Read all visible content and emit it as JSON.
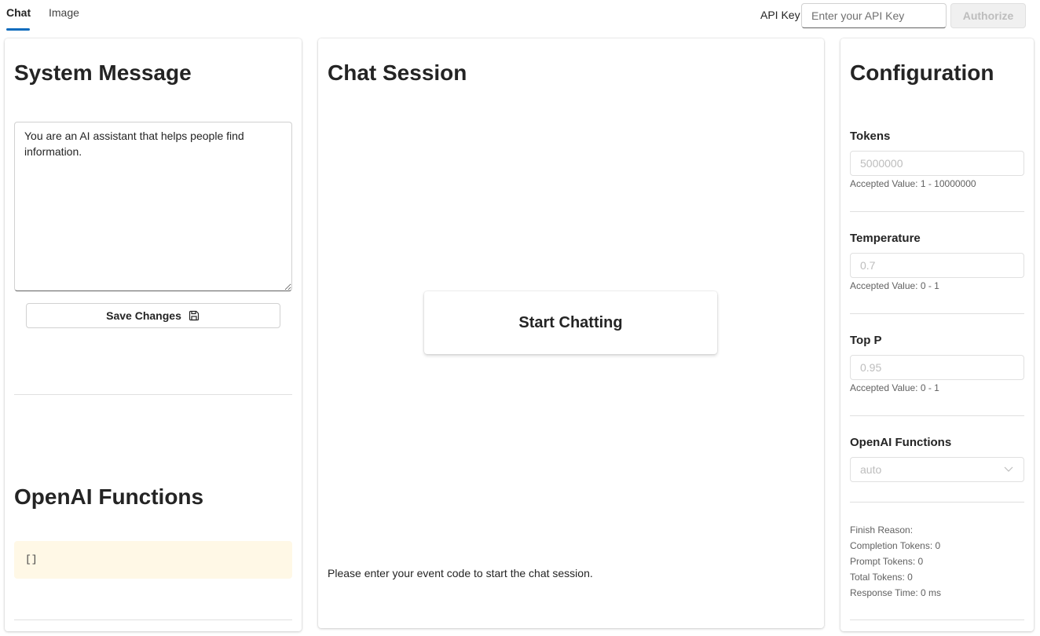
{
  "tabs": [
    {
      "label": "Chat",
      "active": true
    },
    {
      "label": "Image",
      "active": false
    }
  ],
  "auth": {
    "label": "API Key",
    "placeholder": "Enter your API Key",
    "value": "",
    "button_label": "Authorize"
  },
  "system_message": {
    "title": "System Message",
    "text": "You are an AI assistant that helps people find information.",
    "save_label": "Save Changes"
  },
  "functions_panel": {
    "title": "OpenAI Functions",
    "content": "[]"
  },
  "chat_session": {
    "title": "Chat Session",
    "start_label": "Start Chatting",
    "message": "Please enter your event code to start the chat session."
  },
  "configuration": {
    "title": "Configuration",
    "tokens": {
      "label": "Tokens",
      "placeholder": "5000000",
      "hint": "Accepted Value: 1 - 10000000"
    },
    "temperature": {
      "label": "Temperature",
      "placeholder": "0.7",
      "hint": "Accepted Value: 0 - 1"
    },
    "top_p": {
      "label": "Top P",
      "placeholder": "0.95",
      "hint": "Accepted Value: 0 - 1"
    },
    "functions": {
      "label": "OpenAI Functions",
      "selected": "auto"
    },
    "stats": {
      "finish_reason": "Finish Reason:",
      "completion_tokens": "Completion Tokens: 0",
      "prompt_tokens": "Prompt Tokens: 0",
      "total_tokens": "Total Tokens: 0",
      "response_time": "Response Time: 0 ms"
    }
  },
  "colors": {
    "accent": "#0f6cbd",
    "code_background": "#fff8e6"
  }
}
